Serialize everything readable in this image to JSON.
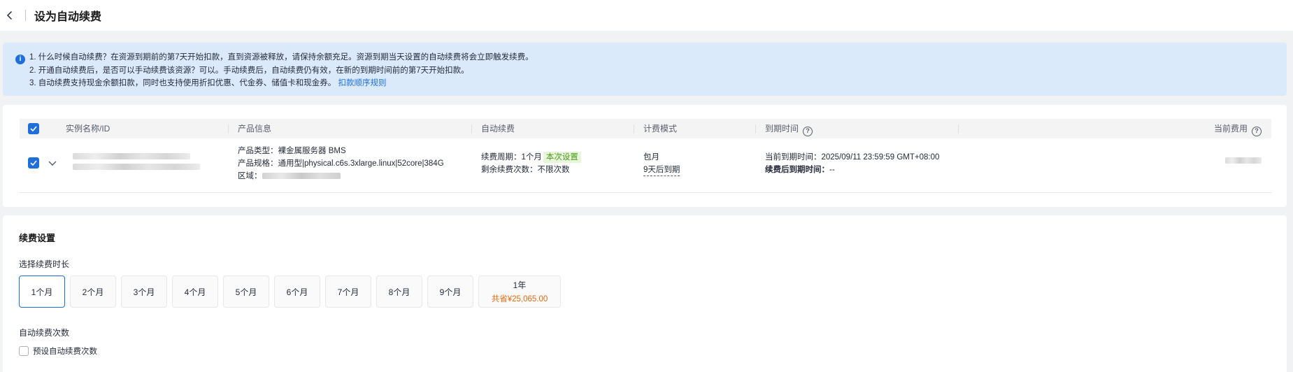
{
  "header": {
    "title": "设为自动续费"
  },
  "notice": {
    "line1": "1. 什么时候自动续费？在资源到期前的第7天开始扣款，直到资源被释放，请保持余额充足。资源到期当天设置的自动续费将会立即触发续费。",
    "line2": "2. 开通自动续费后，是否可以手动续费该资源？可以。手动续费后，自动续费仍有效，在新的到期时间前的第7天开始扣款。",
    "line3": "3. 自动续费支持现金余额扣款，同时也支持使用折扣优惠、代金券、储值卡和现金券。",
    "link": "扣款顺序规则"
  },
  "table": {
    "columns": [
      "实例名称/ID",
      "产品信息",
      "自动续费",
      "计费模式",
      "到期时间",
      "当前费用"
    ],
    "row": {
      "product_type": "产品类型：裸金属服务器 BMS",
      "product_spec": "产品规格：通用型|physical.c6s.3xlarge.linux|52core|384G",
      "region_label": "区域：",
      "renew_period": "续费周期：1个月",
      "renew_tag": "本次设置",
      "renew_remaining": "剩余续费次数：不限次数",
      "billing_mode": "包月",
      "billing_expire": "9天后到期",
      "expire_current": "当前到期时间：2025/09/11 23:59:59 GMT+08:00",
      "expire_after_label": "续费后到期时间：",
      "expire_after_value": "--"
    }
  },
  "settings": {
    "title": "续费设置",
    "duration_label": "选择续费时长",
    "durations": [
      "1个月",
      "2个月",
      "3个月",
      "4个月",
      "5个月",
      "6个月",
      "7个月",
      "8个月",
      "9个月"
    ],
    "year": {
      "label": "1年",
      "saving": "共省¥25,065.00"
    },
    "selected_duration": "1个月",
    "count_label": "自动续费次数",
    "preset_label": "预设自动续费次数",
    "preset_checked": false
  },
  "colors": {
    "accent": "#1e6fd9",
    "saving": "#e06a12",
    "notice_bg": "#dbeafb",
    "tag_bg": "#e8f6dc"
  }
}
